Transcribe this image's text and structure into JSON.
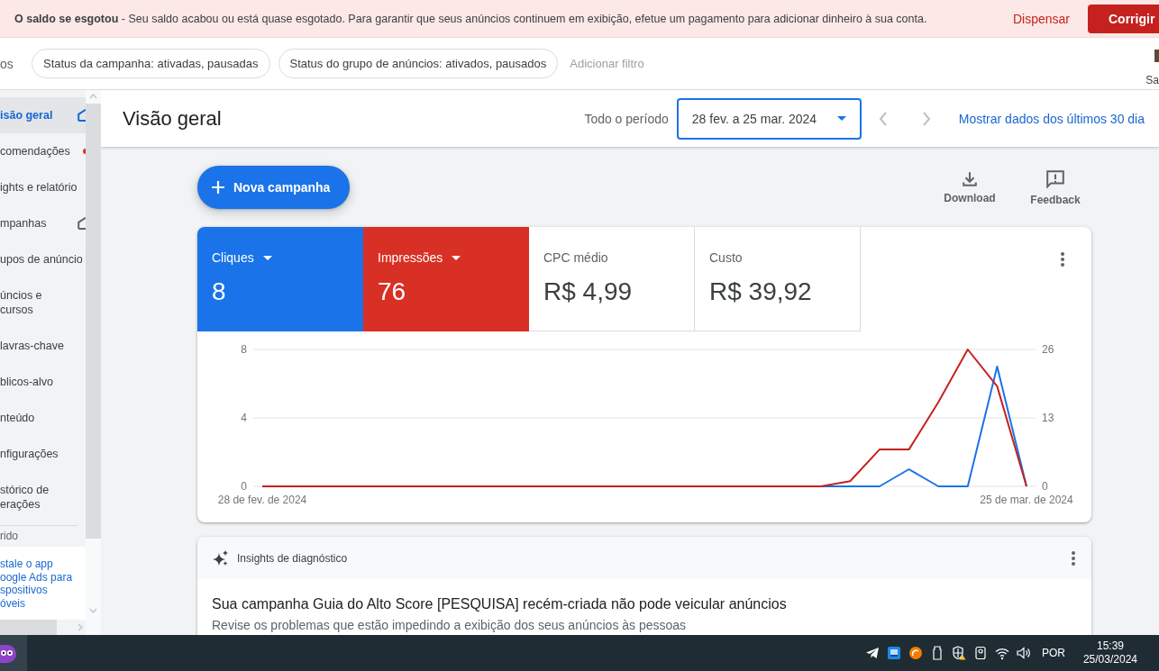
{
  "banner": {
    "message": "**O saldo se esgotou** - Seu saldo acabou ou está quase esgotado. Para garantir que seus anúncios continuem em exibição, efetue um pagamento para adicionar dinheiro à sua conta.",
    "dismiss_button": "Dispensar",
    "fix_button": "Corrigir"
  },
  "filter_bar": {
    "label": "os",
    "filters": [
      "Status da campanha: ativadas, pausadas",
      "Status do grupo de anúncios: ativados, pausados"
    ],
    "add_filter": "Adicionar filtro",
    "tool_label": "Sa"
  },
  "sidebar": {
    "items": [
      {
        "label": "isão geral",
        "kind": "home",
        "selected": true
      },
      {
        "label": "comendações",
        "kind": "alert",
        "selected": false
      },
      {
        "label": "ights e relatório",
        "kind": "plain",
        "selected": false
      },
      {
        "label": "mpanhas",
        "kind": "home",
        "selected": false
      },
      {
        "label": "upos de anúncio",
        "kind": "plain",
        "selected": false
      },
      {
        "label": "úncios e\ncursos",
        "kind": "plain",
        "selected": false
      },
      {
        "label": "lavras-chave",
        "kind": "plain",
        "selected": false
      },
      {
        "label": "blicos-alvo",
        "kind": "plain",
        "selected": false
      },
      {
        "label": "nteúdo",
        "kind": "plain",
        "selected": false
      },
      {
        "label": "nfigurações",
        "kind": "plain",
        "selected": false
      },
      {
        "label": "stórico de\nerações",
        "kind": "plain",
        "selected": false
      }
    ],
    "section_label": "rido",
    "install_link": "stale o app\noogle Ads para\nspositivos\nóveis"
  },
  "header": {
    "title": "Visão geral",
    "period_label": "Todo o período",
    "date_range": "28 fev. a 25 mar. 2024",
    "link": "Mostrar dados dos últimos 30 dia"
  },
  "actions": {
    "new_campaign": "Nova campanha",
    "download": "Download",
    "feedback": "Feedback"
  },
  "performance": {
    "metrics": [
      {
        "label": "Cliques",
        "value": "8",
        "selected": true,
        "color": "#1a73e8"
      },
      {
        "label": "Impressões",
        "value": "76",
        "selected": true,
        "color": "#d93025"
      },
      {
        "label": "CPC médio",
        "value": "R$ 4,99",
        "selected": false
      },
      {
        "label": "Custo",
        "value": "R$ 39,92",
        "selected": false
      }
    ],
    "chart_data": {
      "type": "line",
      "categories": [
        "28 de fev. de 2024",
        null,
        null,
        null,
        null,
        null,
        null,
        null,
        null,
        null,
        null,
        null,
        null,
        null,
        null,
        null,
        null,
        null,
        null,
        null,
        null,
        null,
        null,
        null,
        null,
        null,
        "25 de mar. de 2024"
      ],
      "ylim": [
        0,
        8
      ],
      "yticks": [
        0,
        4,
        8
      ],
      "y2lim": [
        0,
        26
      ],
      "y2ticks": [
        0,
        13,
        26
      ],
      "series": [
        {
          "color": "#1a73e8",
          "values": [
            null,
            null,
            null,
            null,
            null,
            null,
            null,
            null,
            null,
            null,
            null,
            null,
            null,
            null,
            null,
            null,
            null,
            null,
            null,
            0,
            0,
            0,
            1,
            0,
            0,
            7,
            0
          ]
        },
        {
          "color": "#c5221f",
          "axis": "y2",
          "values": [
            0,
            0,
            0,
            0,
            0,
            0,
            0,
            0,
            0,
            0,
            0,
            0,
            0,
            0,
            0,
            0,
            0,
            0,
            0,
            0,
            1,
            7,
            7,
            16,
            26,
            19,
            0
          ]
        }
      ]
    }
  },
  "insights": {
    "title": "Insights de diagnóstico",
    "headline": "Sua campanha Guia do Alto Score [PESQUISA] recém-criada não pode veicular anúncios",
    "description": "Revise os problemas que estão impedindo a exibição dos seus anúncios às pessoas"
  },
  "taskbar": {
    "language": "POR",
    "time": "15:39",
    "date": "25/03/2024"
  }
}
